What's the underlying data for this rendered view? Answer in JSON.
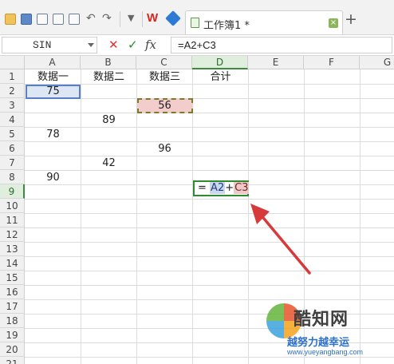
{
  "toolbar": {
    "icons": [
      "open-folder-icon",
      "save-icon",
      "save-as-icon",
      "print-icon",
      "print-preview-icon",
      "undo-icon",
      "redo-icon",
      "more-icon",
      "wps-logo",
      "cube-icon"
    ],
    "wps_logo_text": "W",
    "brand_color": "#d8261d"
  },
  "tab": {
    "title": "工作簿1 *",
    "close_glyph": "×",
    "add_glyph": "+"
  },
  "formula_bar": {
    "name_box": "SIN",
    "cancel_glyph": "✕",
    "accept_glyph": "✓",
    "fx_label": "fx",
    "formula": "=A2+C3"
  },
  "grid": {
    "columns": [
      "A",
      "B",
      "C",
      "D",
      "E",
      "F",
      "G"
    ],
    "rows": [
      "1",
      "2",
      "3",
      "4",
      "5",
      "6",
      "7",
      "8",
      "9",
      "10",
      "11",
      "12",
      "13",
      "14",
      "15",
      "16",
      "17",
      "18",
      "19",
      "20",
      "21"
    ],
    "active_column": "D",
    "active_row": "9",
    "headers": {
      "A1": "数据一",
      "B1": "数据二",
      "C1": "数据三",
      "D1": "合计"
    },
    "values": {
      "A2": "75",
      "C3": "56",
      "B4": "89",
      "A5": "78",
      "C6": "96",
      "B7": "42",
      "A8": "90"
    },
    "editing_cell": {
      "ref": "D9",
      "prefix": "=",
      "ref1": "A2",
      "op": "+",
      "ref2": "C3"
    }
  },
  "colors": {
    "accent_green": "#2e8b2e",
    "ref_blue": "#5b7fc4",
    "ref_red": "#f3cccc",
    "arrow": "#d73a3a"
  },
  "watermark": {
    "brand": "酷知网",
    "tag": "越努力越幸运",
    "url": "www.yueyangbang.com"
  }
}
